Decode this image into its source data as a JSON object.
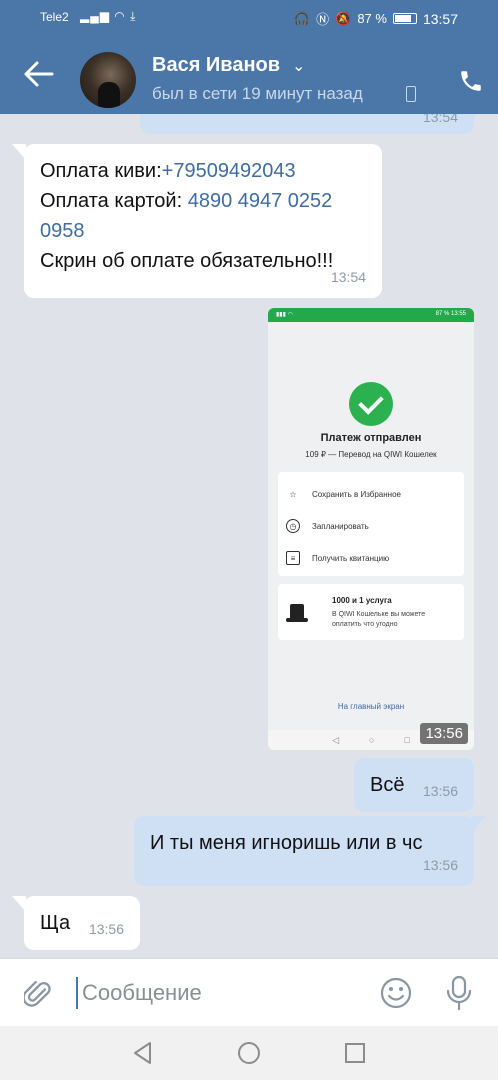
{
  "status_bar": {
    "carrier": "Tele2",
    "battery": "87 %",
    "time": "13:57",
    "icons": [
      "signal-icon",
      "wifi-icon",
      "download-icon",
      "headset-icon",
      "nfc-icon",
      "mute-icon",
      "battery-icon"
    ]
  },
  "header": {
    "name": "Вася Иванов",
    "last_seen": "был в сети 19 минут назад",
    "icons": [
      "back-arrow-icon",
      "chevron-down-icon",
      "mobile-device-icon",
      "phone-call-icon"
    ]
  },
  "messages": [
    {
      "direction": "incoming",
      "line1_label": "Оплата киви:",
      "line1_value": "+79509492043",
      "line2_label": "Оплата картой: ",
      "line2_value_a": "4890 4947 0252",
      "line2_value_b": "0958",
      "line3": "Скрин об оплате обязательно!!!",
      "time": "13:54"
    },
    {
      "direction": "outgoing",
      "type": "image",
      "time": "13:56",
      "image": {
        "status_time": "13:55",
        "status_battery": "87 %",
        "title": "Платеж отправлен",
        "subtitle": "109 ₽ — Перевод на QIWI Кошелек",
        "actions": [
          "Сохранить в Избранное",
          "Запланировать",
          "Получить квитанцию"
        ],
        "promo_title": "1000 и 1 услуга",
        "promo_text": "В QIWI Кошельке вы можете оплатить что угодно",
        "home_link": "На главный экран"
      }
    },
    {
      "direction": "outgoing",
      "text": "Всё",
      "time": "13:56"
    },
    {
      "direction": "outgoing",
      "text": "И ты меня игноришь или в чс",
      "time": "13:56"
    },
    {
      "direction": "incoming",
      "text": "Ща",
      "time": "13:56"
    }
  ],
  "partial_top_time": "13:54",
  "input": {
    "placeholder": "Сообщение",
    "icons": [
      "attach-icon",
      "emoji-icon",
      "microphone-icon"
    ]
  },
  "system_nav": {
    "icons": [
      "nav-back-icon",
      "nav-home-icon",
      "nav-recent-icon"
    ]
  },
  "colors": {
    "header": "#4a76a8",
    "background": "#dfe3e9",
    "outgoing_bubble": "#cfe0f5",
    "incoming_bubble": "#ffffff",
    "link": "#3f6da1"
  }
}
